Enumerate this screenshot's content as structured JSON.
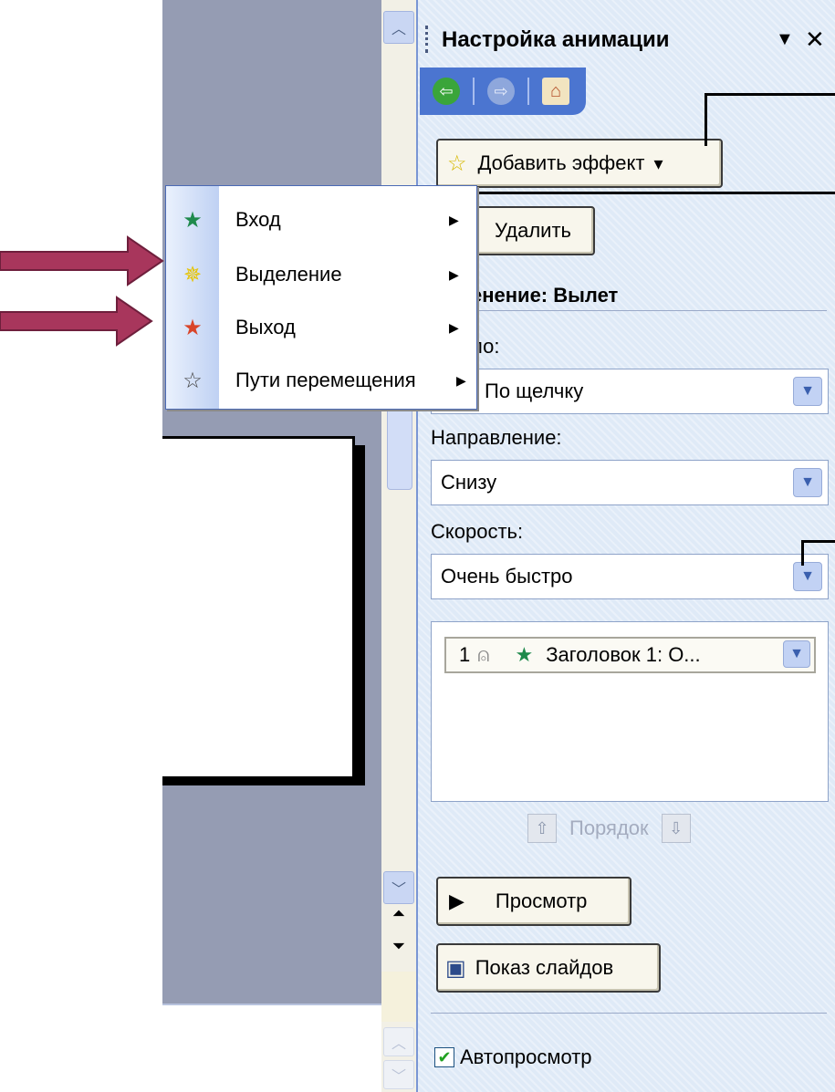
{
  "pane": {
    "title": "Настройка анимации",
    "menu_icon": "▼",
    "close_icon": "✕"
  },
  "nav": {
    "back_icon": "back-arrow-icon",
    "forward_icon": "forward-arrow-icon",
    "home_icon": "home-icon"
  },
  "add_effect": {
    "label": "Добавить эффект",
    "arrow": "▾"
  },
  "delete_button": {
    "label": "Удалить"
  },
  "effect_heading": "енение: Вылет",
  "start": {
    "label": "ло:",
    "value": "По щелчку"
  },
  "direction": {
    "label": "Направление:",
    "value": "Снизу"
  },
  "speed": {
    "label": "Скорость:",
    "value": "Очень быстро"
  },
  "effect_list": {
    "items": [
      {
        "number": "1",
        "name": "Заголовок 1: О..."
      }
    ]
  },
  "order": {
    "label": "Порядок"
  },
  "preview_button": {
    "label": "Просмотр"
  },
  "slideshow_button": {
    "label": "Показ слайдов"
  },
  "autopreview": {
    "label": "Автопросмотр",
    "checked": true
  },
  "menu": {
    "items": [
      {
        "label": "Вход",
        "icon": "entrance-star-icon",
        "color": "#1f8a4c"
      },
      {
        "label": "Выделение",
        "icon": "emphasis-star-icon",
        "color": "#e6c300"
      },
      {
        "label": "Выход",
        "icon": "exit-star-icon",
        "color": "#d9452a"
      },
      {
        "label": "Пути перемещения",
        "icon": "motion-path-star-icon",
        "color": "#ffffff"
      }
    ]
  },
  "colors": {
    "slide_area": "#959cb3",
    "pane_bg": "#dfeaf7",
    "nav_bar": "#4b75d0",
    "annotation_arrow": "#a8365c"
  }
}
